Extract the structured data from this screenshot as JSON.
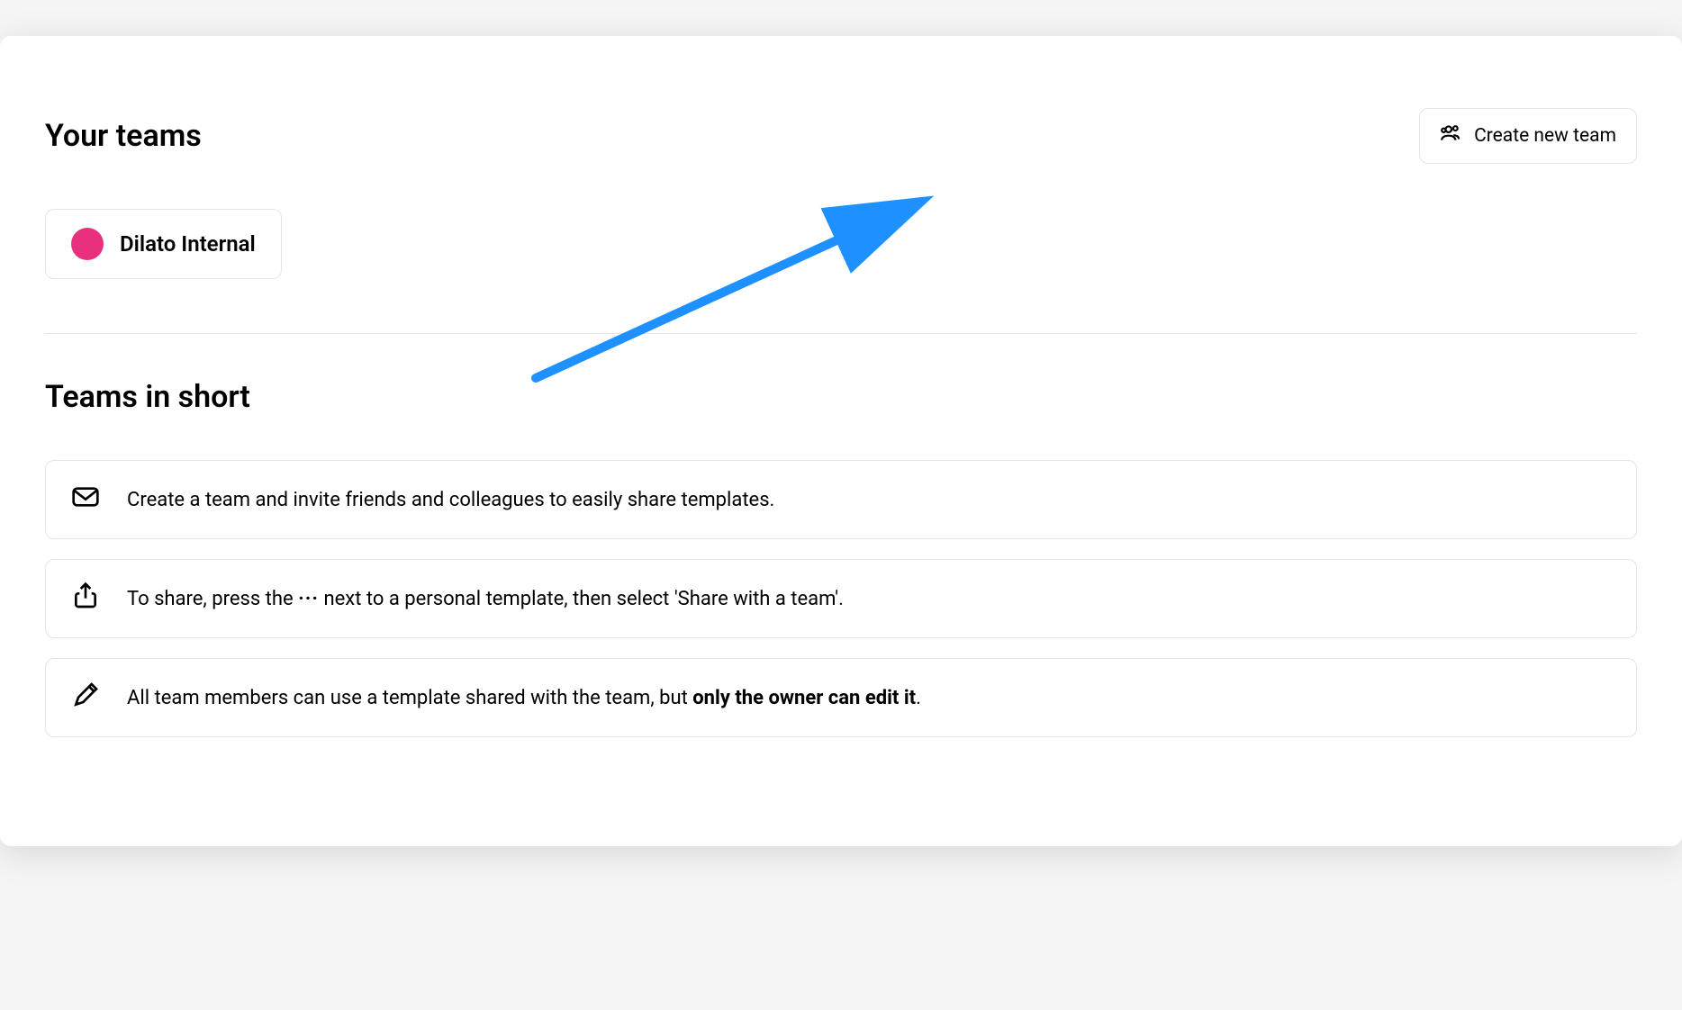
{
  "header": {
    "title": "Your teams",
    "create_button_label": "Create new team"
  },
  "teams": [
    {
      "name": "Dilato Internal",
      "color": "#e8307f"
    }
  ],
  "info_section": {
    "title": "Teams in short",
    "items": [
      {
        "icon": "mail-icon",
        "text": "Create a team and invite friends and colleagues to easily share templates."
      },
      {
        "icon": "share-icon",
        "text_prefix": "To share, press the ",
        "text_dots": "···",
        "text_suffix": " next to a personal template, then select 'Share with a team'."
      },
      {
        "icon": "pencil-icon",
        "text_prefix": "All team members can use a template shared with the team, but ",
        "text_bold": "only the owner can edit it",
        "text_suffix": "."
      }
    ]
  },
  "annotation": {
    "arrow_color": "#1e90ff"
  }
}
